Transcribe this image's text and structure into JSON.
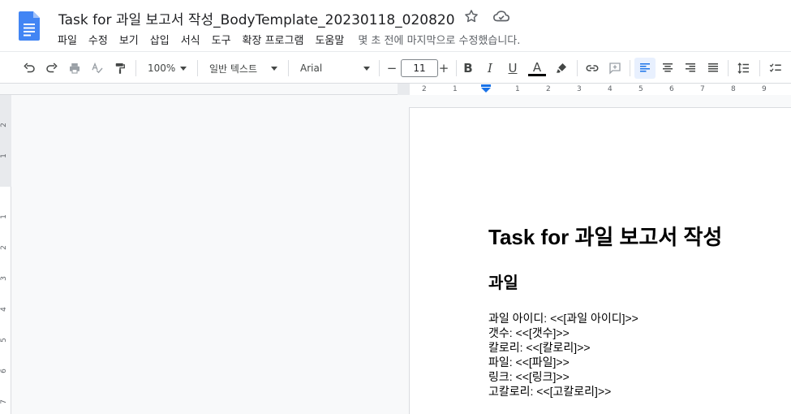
{
  "header": {
    "title": "Task for 과일 보고서 작성_BodyTemplate_20230118_020820",
    "last_edit": "몇 초 전에 마지막으로 수정했습니다."
  },
  "menu": [
    "파일",
    "수정",
    "보기",
    "삽입",
    "서식",
    "도구",
    "확장 프로그램",
    "도움말"
  ],
  "toolbar": {
    "zoom": "100%",
    "style": "일반 텍스트",
    "font": "Arial",
    "font_size": "11",
    "minus": "−",
    "plus": "+",
    "bold": "B",
    "italic": "I",
    "underline": "U",
    "text_color": "A"
  },
  "colors": {
    "brand_blue": "#4285f4",
    "accent": "#1a73e8",
    "active_bg": "#e8f0fe"
  },
  "ruler": {
    "horizontal": [
      "2",
      "1",
      "1",
      "2",
      "3",
      "4",
      "5",
      "6",
      "7",
      "8",
      "9"
    ],
    "vertical": [
      "2",
      "1",
      "1",
      "2",
      "3",
      "4",
      "5",
      "6",
      "7"
    ]
  },
  "document": {
    "heading1": "Task for 과일 보고서 작성",
    "heading2": "과일",
    "lines": [
      "과일 아이디: <<[과일 아이디]>>",
      "갯수: <<[갯수]>>",
      "칼로리: <<[칼로리]>>",
      "파일: <<[파일]>>",
      "링크: <<[링크]>>",
      "고칼로리: <<[고칼로리]>>"
    ]
  }
}
